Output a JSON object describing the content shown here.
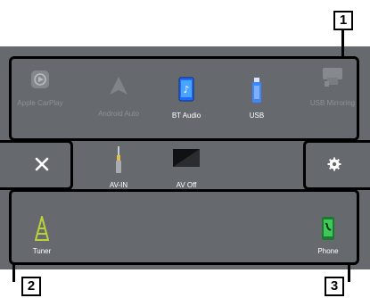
{
  "apps": {
    "apple_carplay": "Apple CarPlay",
    "android_auto": "Android Auto",
    "bt_audio": "BT Audio",
    "usb": "USB",
    "usb_mirroring": "USB Mirroring",
    "av_in": "AV-IN",
    "av_off": "AV Off",
    "tuner": "Tuner",
    "phone": "Phone"
  },
  "callouts": {
    "one": "1",
    "two": "2",
    "three": "3"
  },
  "icons": {
    "close": "close-icon",
    "settings": "gear-icon"
  },
  "colors": {
    "screen_bg": "#666a6e",
    "label": "#ffffff",
    "label_dim": "#8e9296",
    "bt_blue": "#1e6cff",
    "phone_green": "#2fb24a"
  }
}
